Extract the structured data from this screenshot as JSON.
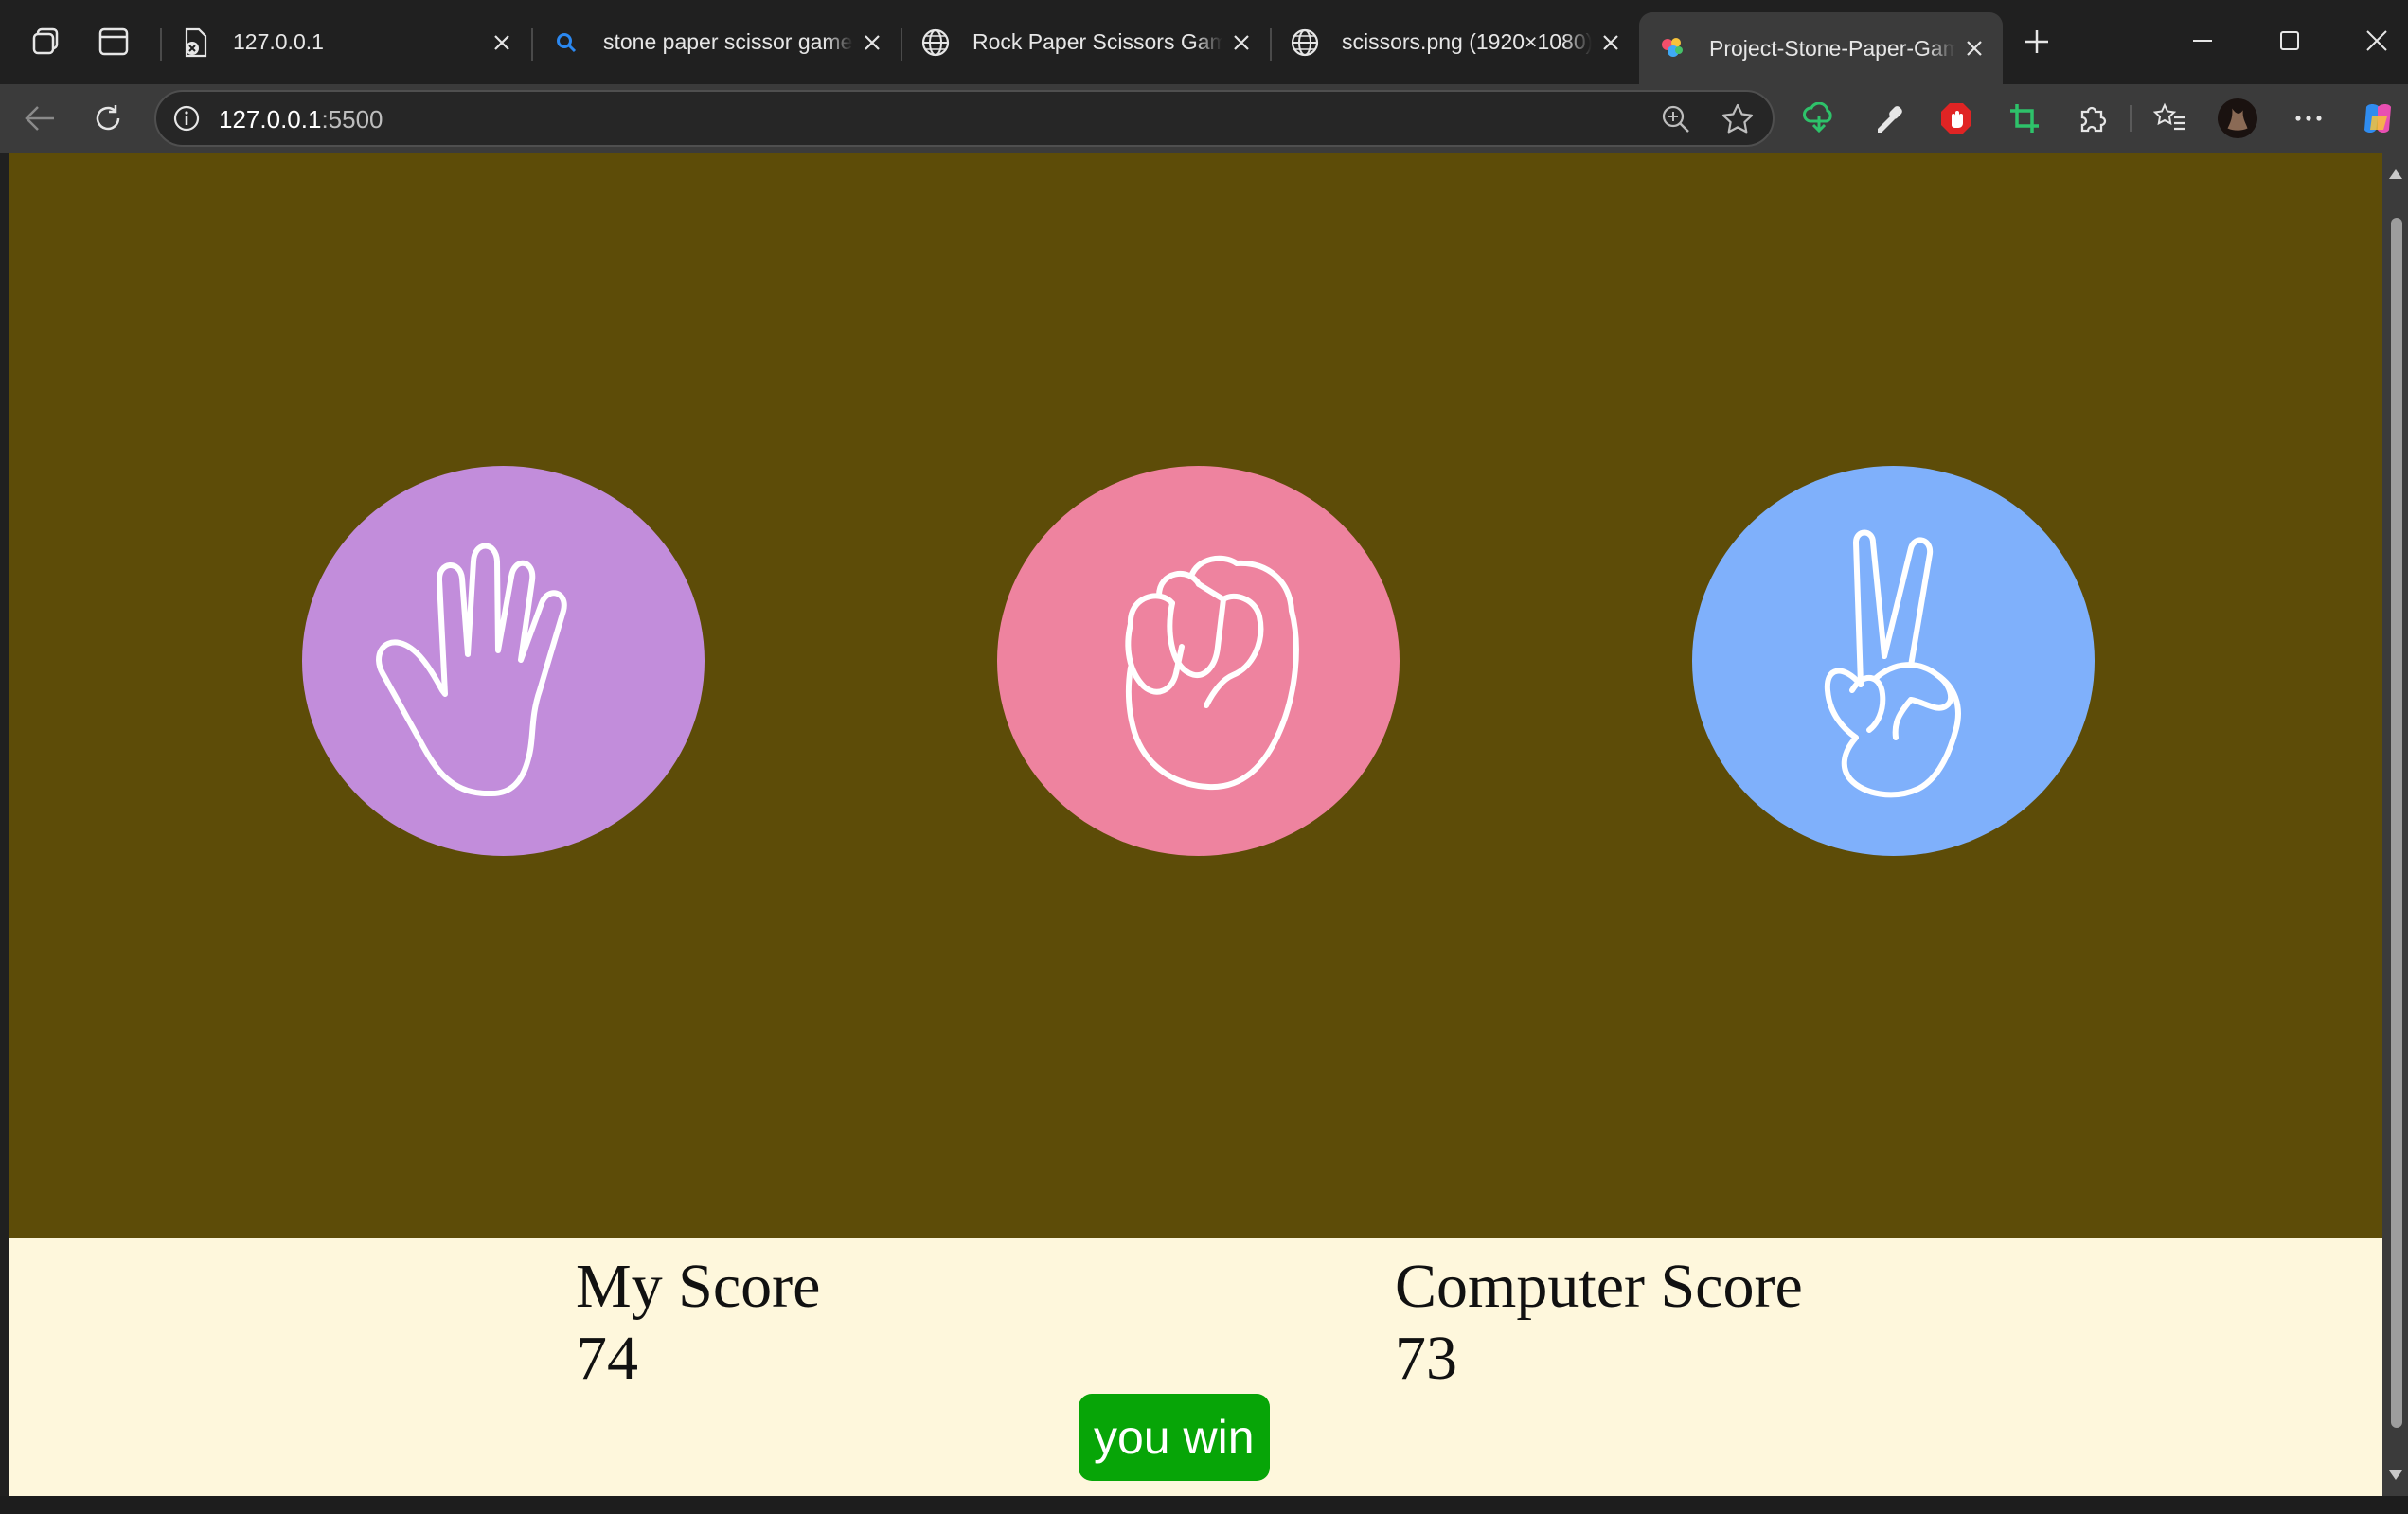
{
  "tabs": [
    {
      "title": "127.0.0.1",
      "favicon": "file-error-icon"
    },
    {
      "title": "stone paper scissor game",
      "favicon": "search-icon"
    },
    {
      "title": "Rock Paper Scissors Game",
      "favicon": "globe-icon"
    },
    {
      "title": "scissors.png (1920×1080)",
      "favicon": "globe-icon"
    },
    {
      "title": "Project-Stone-Paper-Game",
      "favicon": "colorful-logo-icon",
      "active": true
    }
  ],
  "address_bar": {
    "host": "127.0.0.1",
    "port": ":5500"
  },
  "game": {
    "choices": [
      {
        "id": "paper",
        "color": "#c28ddb",
        "icon": "open-hand-icon"
      },
      {
        "id": "rock",
        "color": "#ee839f",
        "icon": "fist-icon"
      },
      {
        "id": "scissors",
        "color": "#7fb0fb",
        "icon": "peace-hand-icon"
      }
    ],
    "background_color": "#5d4c08",
    "score_background_color": "#fef7dc",
    "my_score_label": "My Score",
    "my_score": "74",
    "computer_score_label": "Computer Score",
    "computer_score": "73",
    "message": "you win",
    "message_color": "#07a507"
  }
}
